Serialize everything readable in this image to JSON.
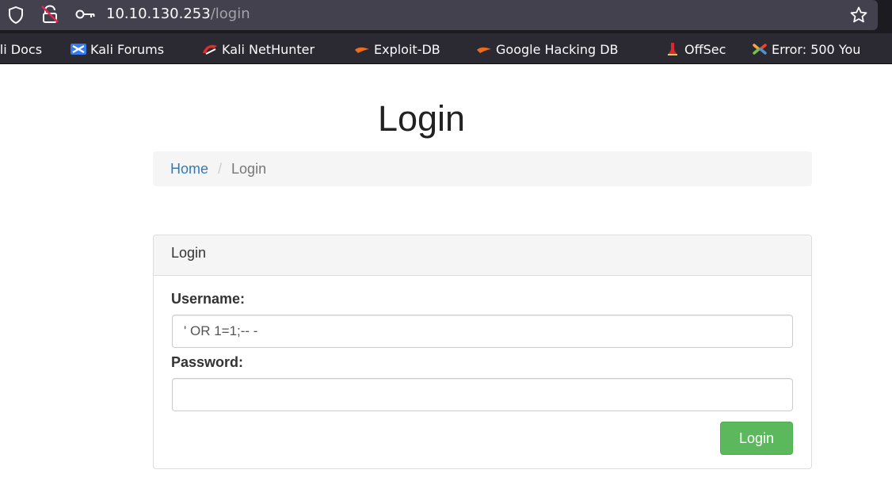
{
  "browser": {
    "url_host": "10.10.130.253",
    "url_path": "/login",
    "icons": {
      "shield": "shield-icon",
      "tracking": "tracking-protection-icon",
      "key": "key-icon",
      "bookmark_star": "star-icon"
    },
    "bookmarks": [
      {
        "label": "ali Docs",
        "icon": "none"
      },
      {
        "label": "Kali Forums",
        "icon": "kali-forums-icon"
      },
      {
        "label": "Kali NetHunter",
        "icon": "kali-nethunter-icon"
      },
      {
        "label": "Exploit-DB",
        "icon": "exploit-db-icon"
      },
      {
        "label": "Google Hacking DB",
        "icon": "google-hacking-db-icon"
      },
      {
        "label": "OffSec",
        "icon": "offsec-icon"
      },
      {
        "label": "Error: 500 You",
        "icon": "joomla-icon"
      }
    ]
  },
  "page": {
    "title": "Login",
    "breadcrumb": {
      "home": "Home",
      "separator": "/",
      "current": "Login"
    },
    "panel": {
      "heading": "Login",
      "username_label": "Username:",
      "username_value": "' OR 1=1;-- -",
      "password_label": "Password:",
      "password_value": "",
      "submit_label": "Login"
    }
  },
  "colors": {
    "link": "#337ab7",
    "success_button": "#5cb85c",
    "chrome_dark": "#1c1b22",
    "urlbar": "#42414d"
  }
}
